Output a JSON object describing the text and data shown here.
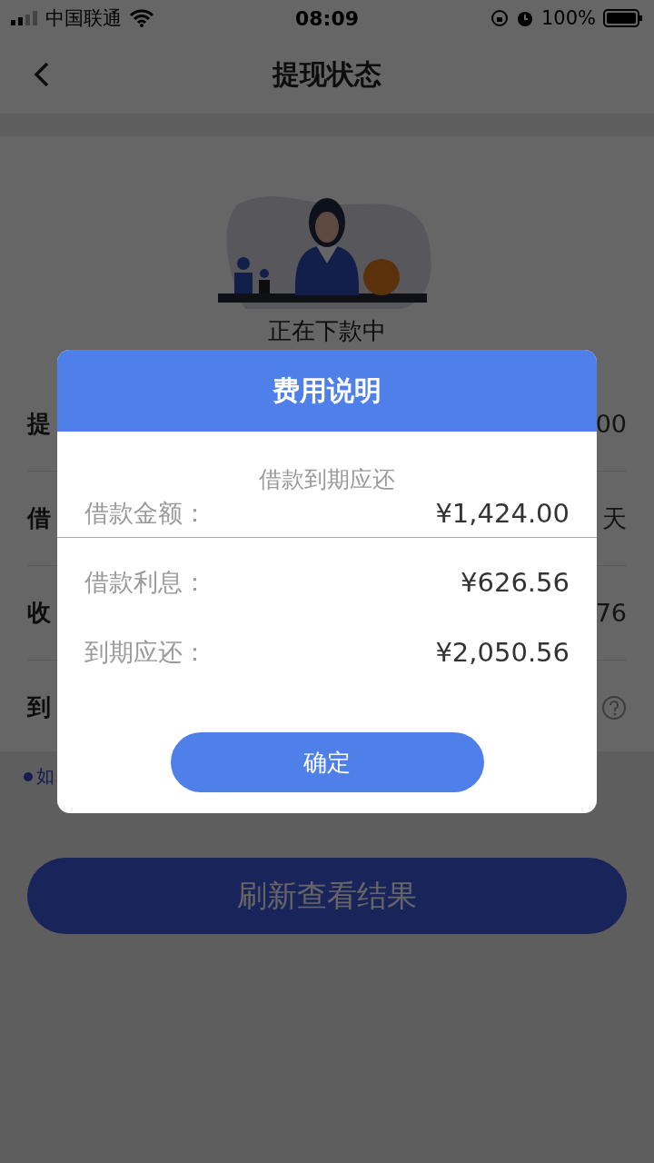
{
  "status_bar": {
    "carrier": "中国联通",
    "time": "08:09",
    "battery": "100%"
  },
  "nav": {
    "title": "提现状态"
  },
  "status_text": "正在下款中",
  "rows": [
    {
      "label": "提",
      "value": "00",
      "kind": "text"
    },
    {
      "label": "借",
      "value": "天",
      "kind": "text"
    },
    {
      "label": "收",
      "value": "76",
      "kind": "text"
    },
    {
      "label": "到",
      "kind": "help"
    }
  ],
  "note": "如",
  "refresh_button": "刷新查看结果",
  "dialog": {
    "title": "费用说明",
    "subtitle": "借款到期应还",
    "items": [
      {
        "label": "借款金额：",
        "value": "¥1,424.00"
      },
      {
        "label": "借款利息：",
        "value": "¥626.56"
      },
      {
        "label": "到期应还：",
        "value": "¥2,050.56"
      }
    ],
    "confirm": "确定"
  }
}
